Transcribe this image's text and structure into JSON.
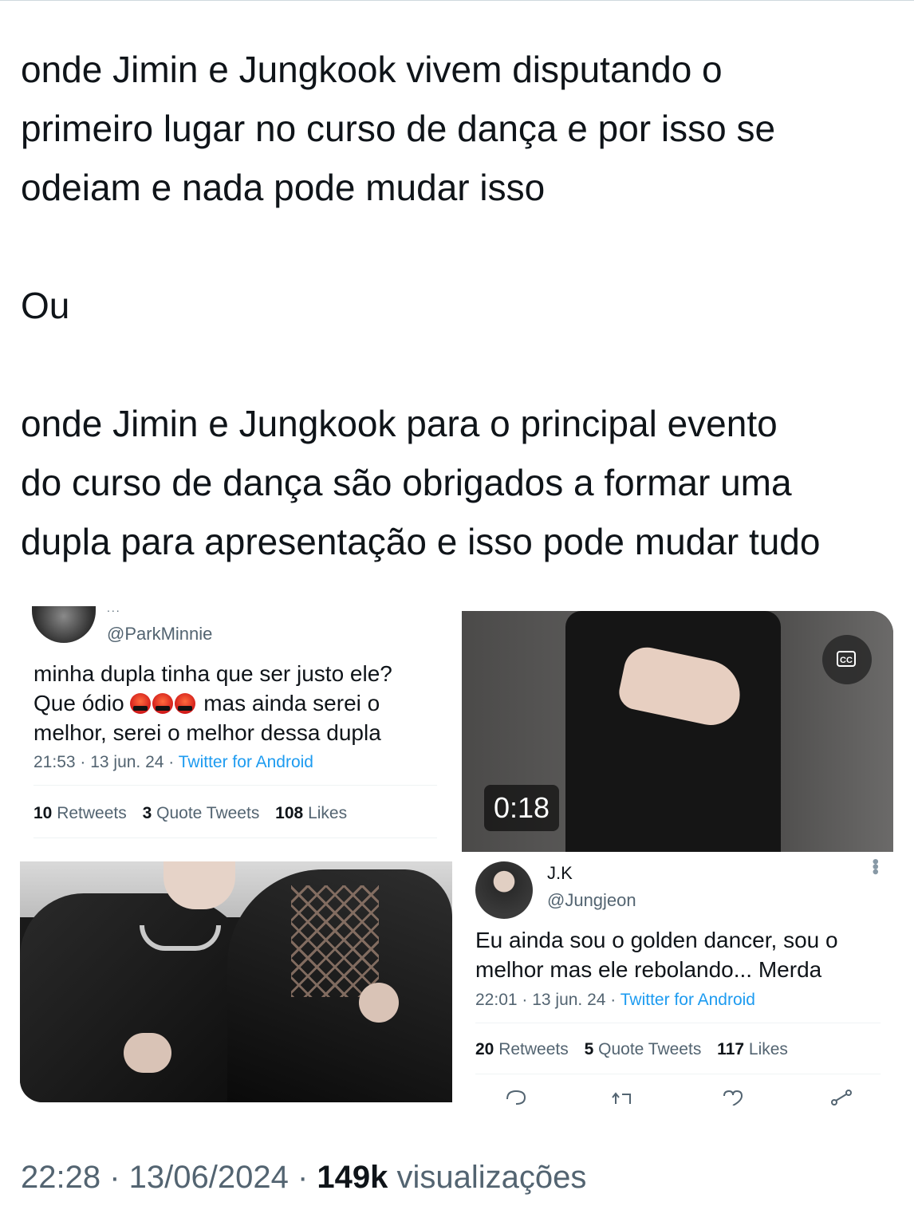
{
  "tweet": {
    "text_lines": [
      "onde Jimin e Jungkook vivem disputando o",
      "primeiro lugar no curso de dança e por isso se",
      "odeiam e nada pode mudar isso",
      "Ou",
      "onde Jimin e Jungkook para o principal evento",
      "do curso de dança são obrigados a formar uma",
      "dupla para apresentação e isso pode mudar tudo"
    ],
    "timestamp": "22:28 · 13/06/2024 · ",
    "views_count": "149k",
    "views_label": " visualizações"
  },
  "embed_1": {
    "dots": "...",
    "handle": "@ParkMinnie",
    "body_line1": "minha dupla tinha que ser justo ele?",
    "body_line2_a": "Que ódio ",
    "body_line2_b": " mas ainda serei o",
    "body_line3": "melhor, serei o melhor dessa dupla",
    "meta": "21:53 · 13 jun. 24 · ",
    "client": "Twitter for Android",
    "retweets_count": "10",
    "retweets_label": "Retweets",
    "quotes_count": "3",
    "quotes_label": "Quote Tweets",
    "likes_count": "108",
    "likes_label": "Likes",
    "emoji_icon": "angry-face-with-symbols-icon"
  },
  "video": {
    "cc_label": "CC",
    "duration": "0:18"
  },
  "embed_2": {
    "name": "J.K",
    "handle": "@Jungjeon",
    "body_line1": "Eu ainda sou o golden dancer, sou o",
    "body_line2": "melhor mas ele rebolando... Merda",
    "meta": "22:01 · 13 jun. 24 · ",
    "client": "Twitter for Android",
    "retweets_count": "20",
    "retweets_label": "Retweets",
    "quotes_count": "5",
    "quotes_label": "Quote Tweets",
    "likes_count": "117",
    "likes_label": "Likes",
    "actions": [
      "reply-icon",
      "retweet-icon",
      "like-icon",
      "share-icon"
    ]
  },
  "colors": {
    "text": "#0f1419",
    "secondary": "#536471",
    "link": "#1d9bf0"
  }
}
